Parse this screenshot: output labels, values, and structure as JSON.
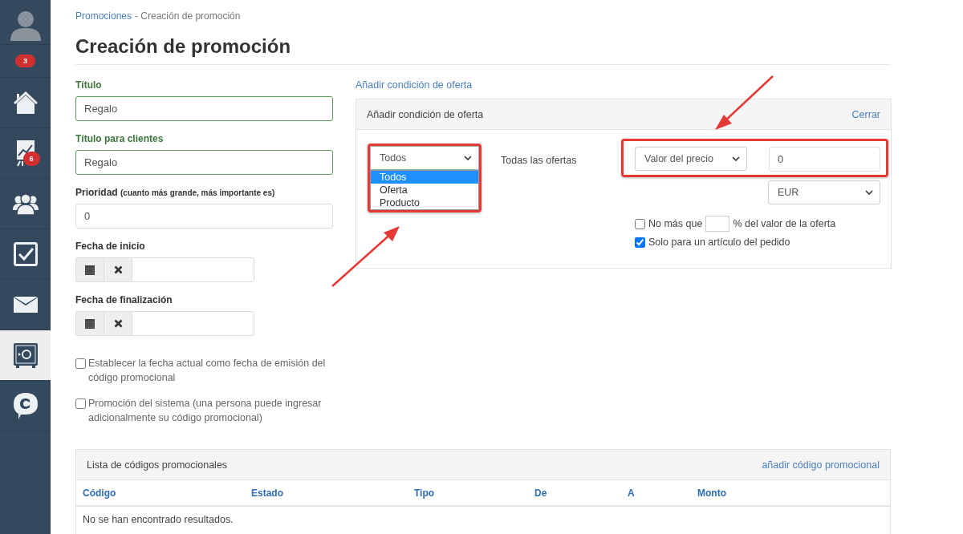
{
  "sidebar": {
    "notification_badge": "3",
    "items": [
      {
        "kind": "home",
        "selected": false
      },
      {
        "kind": "chart",
        "badge": "6",
        "selected": false
      },
      {
        "kind": "users",
        "selected": false
      },
      {
        "kind": "tasks",
        "selected": false
      },
      {
        "kind": "mail",
        "selected": false
      },
      {
        "kind": "safe",
        "selected": true
      },
      {
        "kind": "chat",
        "selected": false
      }
    ]
  },
  "breadcrumb": {
    "link": "Promociones",
    "current": "- Creación de promoción"
  },
  "title": "Creación de promoción",
  "form": {
    "fields": [
      {
        "kind": "text",
        "label": "Título",
        "value": "Regalo",
        "valid": true
      },
      {
        "kind": "text",
        "label": "Título para clientes",
        "value": "Regalo",
        "valid": true
      },
      {
        "kind": "text",
        "label": "Prioridad",
        "hint": "(cuanto más grande, más importante es)",
        "value": "0",
        "valid": false
      },
      {
        "kind": "date",
        "label": "Fecha de inicio"
      },
      {
        "kind": "date",
        "label": "Fecha de finalización"
      }
    ],
    "checkboxes": [
      {
        "label": "Establecer la fecha actual como fecha de emisión del código promocional",
        "checked": false
      },
      {
        "label": "Promoción del sistema (una persona puede ingresar adicionalmente su código promocional)",
        "checked": false
      }
    ]
  },
  "offer_condition": {
    "add_link": "Añadir condición de oferta",
    "panel_title": "Añadir condición de oferta",
    "close_link": "Cerrar",
    "type_select": {
      "value": "Todos",
      "options": [
        {
          "label": "Todos",
          "selected": true
        },
        {
          "label": "Oferta",
          "selected": false
        },
        {
          "label": "Producto",
          "selected": false
        }
      ]
    },
    "scope_text": "Todas las ofertas",
    "condition_select": "Valor del precio",
    "value": "0",
    "currency_select": "EUR",
    "options": [
      {
        "kind": "limit",
        "before": "No más que",
        "after": "% del valor de la oferta",
        "checked": false
      },
      {
        "kind": "plain",
        "label": "Solo para un artículo del pedido",
        "checked": true
      }
    ]
  },
  "promo_codes": {
    "title": "Lista de códigos promocionales",
    "add_link": "añadir código promocional",
    "columns": [
      "Código",
      "Estado",
      "Tipo",
      "De",
      "A",
      "Monto"
    ],
    "empty_message": "No se han encontrado resultados."
  }
}
